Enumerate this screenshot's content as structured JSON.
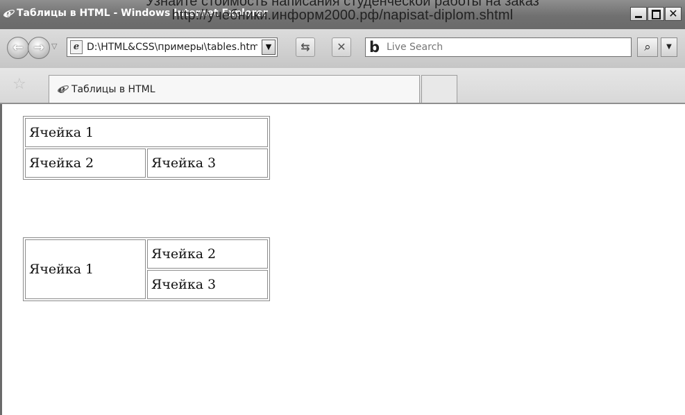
{
  "watermark": {
    "line1": "Узнайте стоимость написания студенческой работы на заказ",
    "line2": "http://учебники.информ2000.рф/napisat-diplom.shtml"
  },
  "window": {
    "title": "Таблицы в HTML - Windows Internet Explorer",
    "icon": "ie-icon"
  },
  "toolbar": {
    "back_icon": "back-arrow-icon",
    "forward_icon": "forward-arrow-icon",
    "address_value": "D:\\HTML&CSS\\примеры\\tables.html",
    "refresh_icon": "refresh-icon",
    "stop_icon": "stop-icon",
    "search_placeholder": "Live Search",
    "search_icon": "magnifier-icon"
  },
  "tabs": {
    "favorites_icon": "star-icon",
    "active_label": "Таблицы в HTML"
  },
  "page": {
    "table1": {
      "row1": [
        "Ячейка 1"
      ],
      "row2": [
        "Ячейка 2",
        "Ячейка 3"
      ]
    },
    "table2": {
      "left": "Ячейка 1",
      "right": [
        "Ячейка 2",
        "Ячейка 3"
      ]
    }
  },
  "colors": {
    "titlebar": "#7a7a7a",
    "toolbar": "#cfcfcf",
    "content_bg": "#ffffff"
  }
}
